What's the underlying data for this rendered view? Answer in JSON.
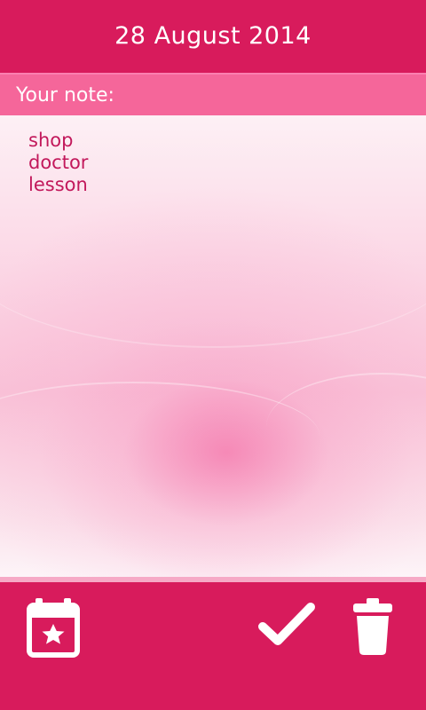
{
  "header": {
    "date": "28 August 2014"
  },
  "label_bar": {
    "label": "Your note:"
  },
  "note": {
    "text": "shop\ndoctor\nlesson"
  },
  "toolbar": {
    "icons": [
      "calendar-star-icon",
      "checkmark-icon",
      "trash-icon"
    ]
  },
  "colors": {
    "primary": "#d81b5c",
    "label_bar": "#f5669a",
    "note_text": "#c2185b",
    "icon": "#ffffff"
  }
}
